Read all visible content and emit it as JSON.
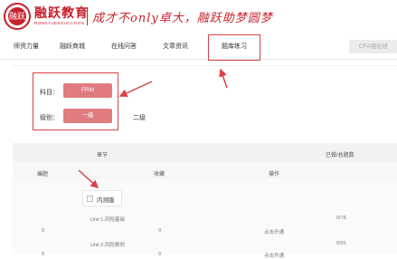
{
  "header": {
    "logo_mark": "融跃",
    "brand_name": "融跃教育",
    "brand_sub": "RONGYUEEDUCATION",
    "slogan": "成才不only卓大，融跃助梦圆梦"
  },
  "nav": {
    "items": [
      {
        "label": "师资力量"
      },
      {
        "label": "融跃商城"
      },
      {
        "label": "在线问答"
      },
      {
        "label": "文章资讯"
      },
      {
        "label": "题库练习"
      }
    ],
    "cfa_button": "CFA强化班"
  },
  "filters": {
    "subject_label": "科目：",
    "subject_value": "FRM",
    "level_label": "级别：",
    "level_value": "一级",
    "level_option_2": "二级"
  },
  "table": {
    "headers": {
      "chapter": "章节",
      "progress": "已做/总题数",
      "number": "编题",
      "favorite": "收藏",
      "action": "操作"
    },
    "group_label": "内测版",
    "group_toggle": "-",
    "rows": [
      {
        "name": "Unit 1.风险基础",
        "progress": "0/75",
        "number": "0",
        "favorite": "0",
        "action": "点击开通"
      },
      {
        "name": "Unit 2.风险案例",
        "progress": "0/01",
        "number": "0",
        "favorite": "0",
        "action": "点击开通"
      }
    ]
  },
  "colors": {
    "brand_red": "#c8202b",
    "pill_pink": "#e07b81",
    "highlight_red": "#d9424a"
  }
}
